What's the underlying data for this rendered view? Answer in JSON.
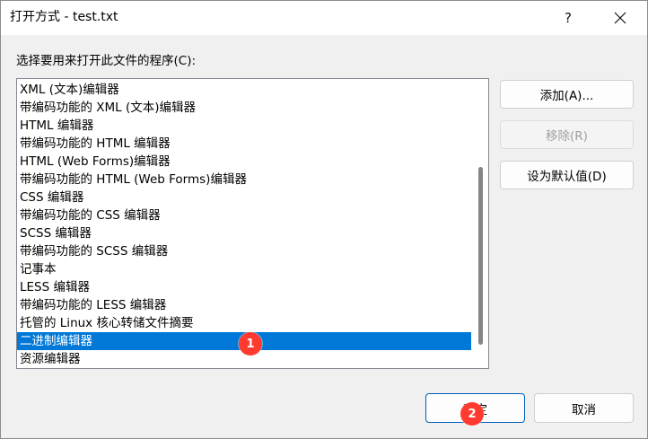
{
  "window": {
    "title": "打开方式 - test.txt",
    "help_label": "?",
    "close_icon": "close-icon"
  },
  "prompt": "选择要用来打开此文件的程序(C):",
  "programs": [
    "XML (文本)编辑器",
    "带编码功能的 XML (文本)编辑器",
    "HTML 编辑器",
    "带编码功能的 HTML 编辑器",
    "HTML (Web Forms)编辑器",
    "带编码功能的 HTML (Web Forms)编辑器",
    "CSS 编辑器",
    "带编码功能的 CSS 编辑器",
    "SCSS 编辑器",
    "带编码功能的 SCSS 编辑器",
    "记事本",
    "LESS 编辑器",
    "带编码功能的 LESS 编辑器",
    "托管的 Linux 核心转储文件摘要",
    "二进制编辑器",
    "资源编辑器"
  ],
  "selected_program": "二进制编辑器",
  "buttons": {
    "add": "添加(A)...",
    "remove": "移除(R)",
    "set_default": "设为默认值(D)",
    "ok": "确定",
    "cancel": "取消"
  },
  "annotations": {
    "step1": "1",
    "step2": "2"
  },
  "colors": {
    "selection": "#0078d7",
    "badge": "#ff3b30",
    "default_button_border": "#005fb8"
  }
}
